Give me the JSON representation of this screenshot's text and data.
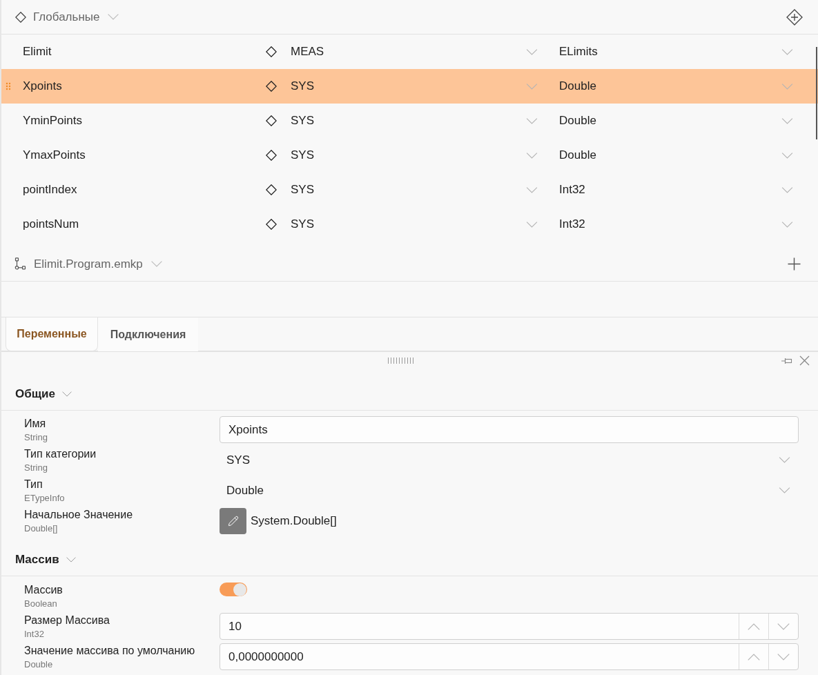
{
  "globals": {
    "title": "Глобальные"
  },
  "variables": [
    {
      "name": "Elimit",
      "category": "MEAS",
      "type": "ELimits",
      "selected": false
    },
    {
      "name": "Xpoints",
      "category": "SYS",
      "type": "Double",
      "selected": true
    },
    {
      "name": "YminPoints",
      "category": "SYS",
      "type": "Double",
      "selected": false
    },
    {
      "name": "YmaxPoints",
      "category": "SYS",
      "type": "Double",
      "selected": false
    },
    {
      "name": "pointIndex",
      "category": "SYS",
      "type": "Int32",
      "selected": false
    },
    {
      "name": "pointsNum",
      "category": "SYS",
      "type": "Int32",
      "selected": false
    }
  ],
  "program": {
    "title": "Elimit.Program.emkp"
  },
  "tabs": [
    {
      "label": "Переменные",
      "selected": true
    },
    {
      "label": "Подключения",
      "selected": false
    }
  ],
  "property_sections": [
    {
      "title": "Общие",
      "properties": [
        {
          "kind": "text",
          "label": "Имя",
          "type": "String",
          "value": "Xpoints"
        },
        {
          "kind": "dropdown",
          "label": "Тип категории",
          "type": "String",
          "value": "SYS"
        },
        {
          "kind": "dropdown",
          "label": "Тип",
          "type": "ETypeInfo",
          "value": "Double"
        },
        {
          "kind": "editor",
          "label": "Начальное Значение",
          "type": "Double[]",
          "value": "System.Double[]"
        }
      ]
    },
    {
      "title": "Массив",
      "properties": [
        {
          "kind": "toggle",
          "label": "Массив",
          "type": "Boolean",
          "on": true
        },
        {
          "kind": "spinner",
          "label": "Размер Массива",
          "type": "Int32",
          "value": "10"
        },
        {
          "kind": "spinner",
          "label": "Значение массива по умолчанию",
          "type": "Double",
          "value": "0,0000000000"
        }
      ]
    }
  ]
}
